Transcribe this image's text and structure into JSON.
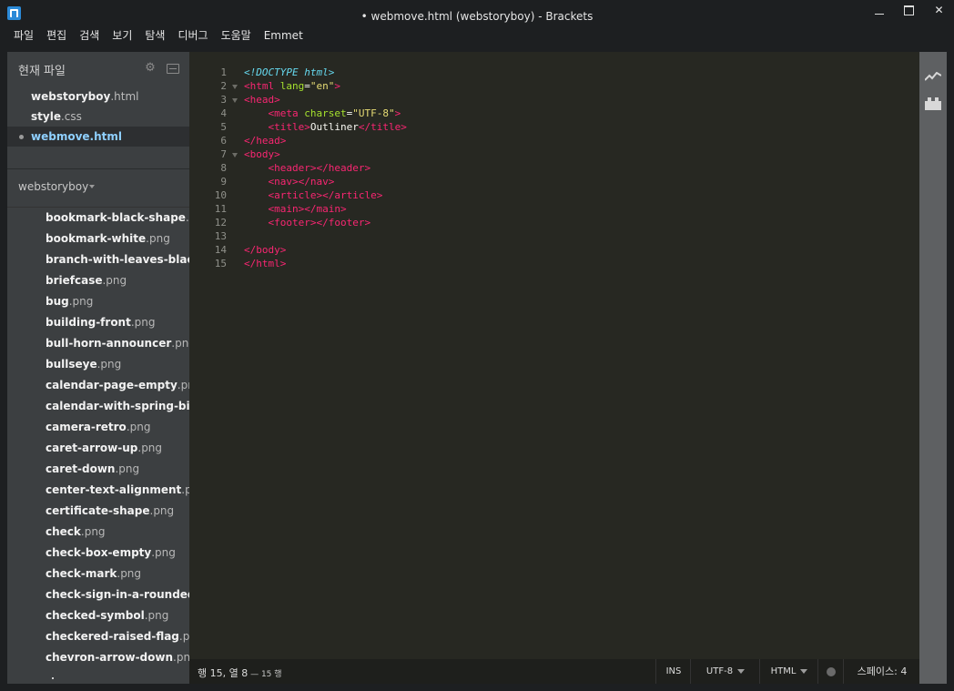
{
  "window": {
    "title": "• webmove.html (webstoryboy) - Brackets",
    "controls": [
      "minimize",
      "maximize",
      "close"
    ]
  },
  "menu": [
    "파일",
    "편집",
    "검색",
    "보기",
    "탐색",
    "디버그",
    "도움말",
    "Emmet"
  ],
  "working_files": {
    "title": "현재 파일",
    "items": [
      {
        "name": "webstoryboy",
        "ext": ".html",
        "active": false
      },
      {
        "name": "style",
        "ext": ".css",
        "active": false
      },
      {
        "name": "webmove.html",
        "ext": "",
        "active": true
      }
    ]
  },
  "project": {
    "title": "webstoryboy",
    "files": [
      {
        "name": "bookmark-black-shape",
        "ext": ".png"
      },
      {
        "name": "bookmark-white",
        "ext": ".png"
      },
      {
        "name": "branch-with-leaves-black-s",
        "ext": ""
      },
      {
        "name": "briefcase",
        "ext": ".png"
      },
      {
        "name": "bug",
        "ext": ".png"
      },
      {
        "name": "building-front",
        "ext": ".png"
      },
      {
        "name": "bull-horn-announcer",
        "ext": ".png"
      },
      {
        "name": "bullseye",
        "ext": ".png"
      },
      {
        "name": "calendar-page-empty",
        "ext": ".png"
      },
      {
        "name": "calendar-with-spring-binde",
        "ext": ""
      },
      {
        "name": "camera-retro",
        "ext": ".png"
      },
      {
        "name": "caret-arrow-up",
        "ext": ".png"
      },
      {
        "name": "caret-down",
        "ext": ".png"
      },
      {
        "name": "center-text-alignment",
        "ext": ".png"
      },
      {
        "name": "certificate-shape",
        "ext": ".png"
      },
      {
        "name": "check",
        "ext": ".png"
      },
      {
        "name": "check-box-empty",
        "ext": ".png"
      },
      {
        "name": "check-mark",
        "ext": ".png"
      },
      {
        "name": "check-sign-in-a-rounded-bl",
        "ext": ""
      },
      {
        "name": "checked-symbol",
        "ext": ".png"
      },
      {
        "name": "checkered-raised-flag",
        "ext": ".png"
      },
      {
        "name": "chevron-arrow-down",
        "ext": ".png"
      }
    ]
  },
  "editor": {
    "line_numbers": [
      "1",
      "2",
      "3",
      "4",
      "5",
      "6",
      "7",
      "8",
      "9",
      "10",
      "11",
      "12",
      "13",
      "14",
      "15"
    ],
    "fold_lines": [
      2,
      3,
      7
    ],
    "lines": [
      [
        [
          "doctype",
          "<!DOCTYPE html>"
        ]
      ],
      [
        [
          "tag",
          "<html "
        ],
        [
          "attr",
          "lang"
        ],
        [
          "text",
          "="
        ],
        [
          "str",
          "\"en\""
        ],
        [
          "tag",
          ">"
        ]
      ],
      [
        [
          "tag",
          "<head>"
        ]
      ],
      [
        [
          "text",
          "    "
        ],
        [
          "tag",
          "<meta "
        ],
        [
          "attr",
          "charset"
        ],
        [
          "text",
          "="
        ],
        [
          "str",
          "\"UTF-8\""
        ],
        [
          "tag",
          ">"
        ]
      ],
      [
        [
          "text",
          "    "
        ],
        [
          "tag",
          "<title>"
        ],
        [
          "text",
          "Outliner"
        ],
        [
          "tag",
          "</title>"
        ]
      ],
      [
        [
          "tag",
          "</head>"
        ]
      ],
      [
        [
          "tag",
          "<body>"
        ]
      ],
      [
        [
          "text",
          "    "
        ],
        [
          "tag",
          "<header></header>"
        ]
      ],
      [
        [
          "text",
          "    "
        ],
        [
          "tag",
          "<nav></nav>"
        ]
      ],
      [
        [
          "text",
          "    "
        ],
        [
          "tag",
          "<article></article>"
        ]
      ],
      [
        [
          "text",
          "    "
        ],
        [
          "tag",
          "<main></main>"
        ]
      ],
      [
        [
          "text",
          "    "
        ],
        [
          "tag",
          "<footer></footer>"
        ]
      ],
      [],
      [
        [
          "tag",
          "</body>"
        ]
      ],
      [
        [
          "tag",
          "</html>"
        ]
      ]
    ]
  },
  "statusbar": {
    "cursor": "행 15, 열 8",
    "line_count": " — 15 행",
    "mode": "INS",
    "encoding": "UTF-8",
    "language": "HTML",
    "indent": "스페이스: 4"
  },
  "colors": {
    "tag": "#f92672",
    "attr": "#a6e22e",
    "string": "#e6db74",
    "doctype": "#66d9ef",
    "editor_bg": "#272822",
    "sidebar_bg": "#3c3f41"
  },
  "icons": {
    "gear": "gear-icon",
    "split": "split-view-icon",
    "live_preview": "live-preview-icon",
    "extensions": "extensions-icon"
  }
}
